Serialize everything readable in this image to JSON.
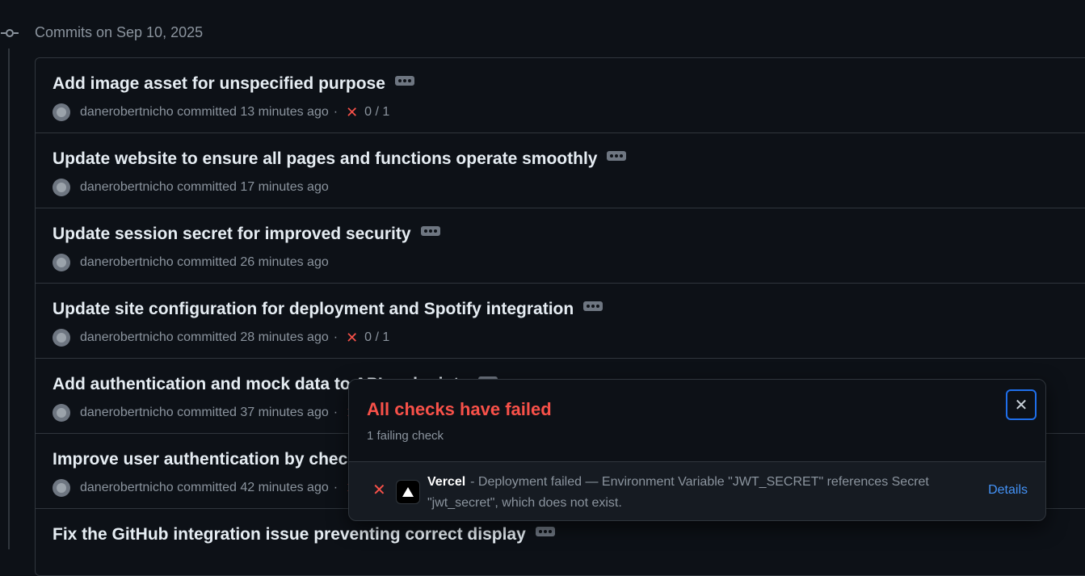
{
  "header": {
    "date_label": "Commits on Sep 10, 2025"
  },
  "commits": [
    {
      "title": "Add image asset for unspecified purpose",
      "author": "danerobertnicho",
      "committed": "committed 13 minutes ago",
      "sep": "·",
      "status": "✕",
      "checks": "0 / 1"
    },
    {
      "title": "Update website to ensure all pages and functions operate smoothly",
      "author": "danerobertnicho",
      "committed": "committed 17 minutes ago",
      "sep": "",
      "status": "",
      "checks": ""
    },
    {
      "title": "Update session secret for improved security",
      "author": "danerobertnicho",
      "committed": "committed 26 minutes ago",
      "sep": "",
      "status": "",
      "checks": ""
    },
    {
      "title": "Update site configuration for deployment and Spotify integration",
      "author": "danerobertnicho",
      "committed": "committed 28 minutes ago",
      "sep": "·",
      "status": "✕",
      "checks": "0 / 1"
    },
    {
      "title": "Add authentication and mock data to API endpoints",
      "author": "danerobertnicho",
      "committed": "committed 37 minutes ago",
      "sep": "·",
      "status": "✕",
      "checks": ""
    },
    {
      "title": "Improve user authentication by checking",
      "author": "danerobertnicho",
      "committed": "committed 42 minutes ago",
      "sep": "·",
      "status": "✕",
      "checks": ""
    },
    {
      "title": "Fix the GitHub integration issue preventing correct display",
      "author": "",
      "committed": "",
      "sep": "",
      "status": "",
      "checks": ""
    }
  ],
  "popover": {
    "title": "All checks have failed",
    "subtitle": "1 failing check",
    "close_icon": "✕",
    "check": {
      "status_icon": "✕",
      "name": "Vercel",
      "description": "- Deployment failed — Environment Variable \"JWT_SECRET\" references Secret \"jwt_secret\", which does not exist.",
      "details_label": "Details"
    }
  },
  "colors": {
    "background": "#0d1117",
    "failure": "#f85149",
    "link": "#4493f8",
    "muted": "#8b949e"
  }
}
